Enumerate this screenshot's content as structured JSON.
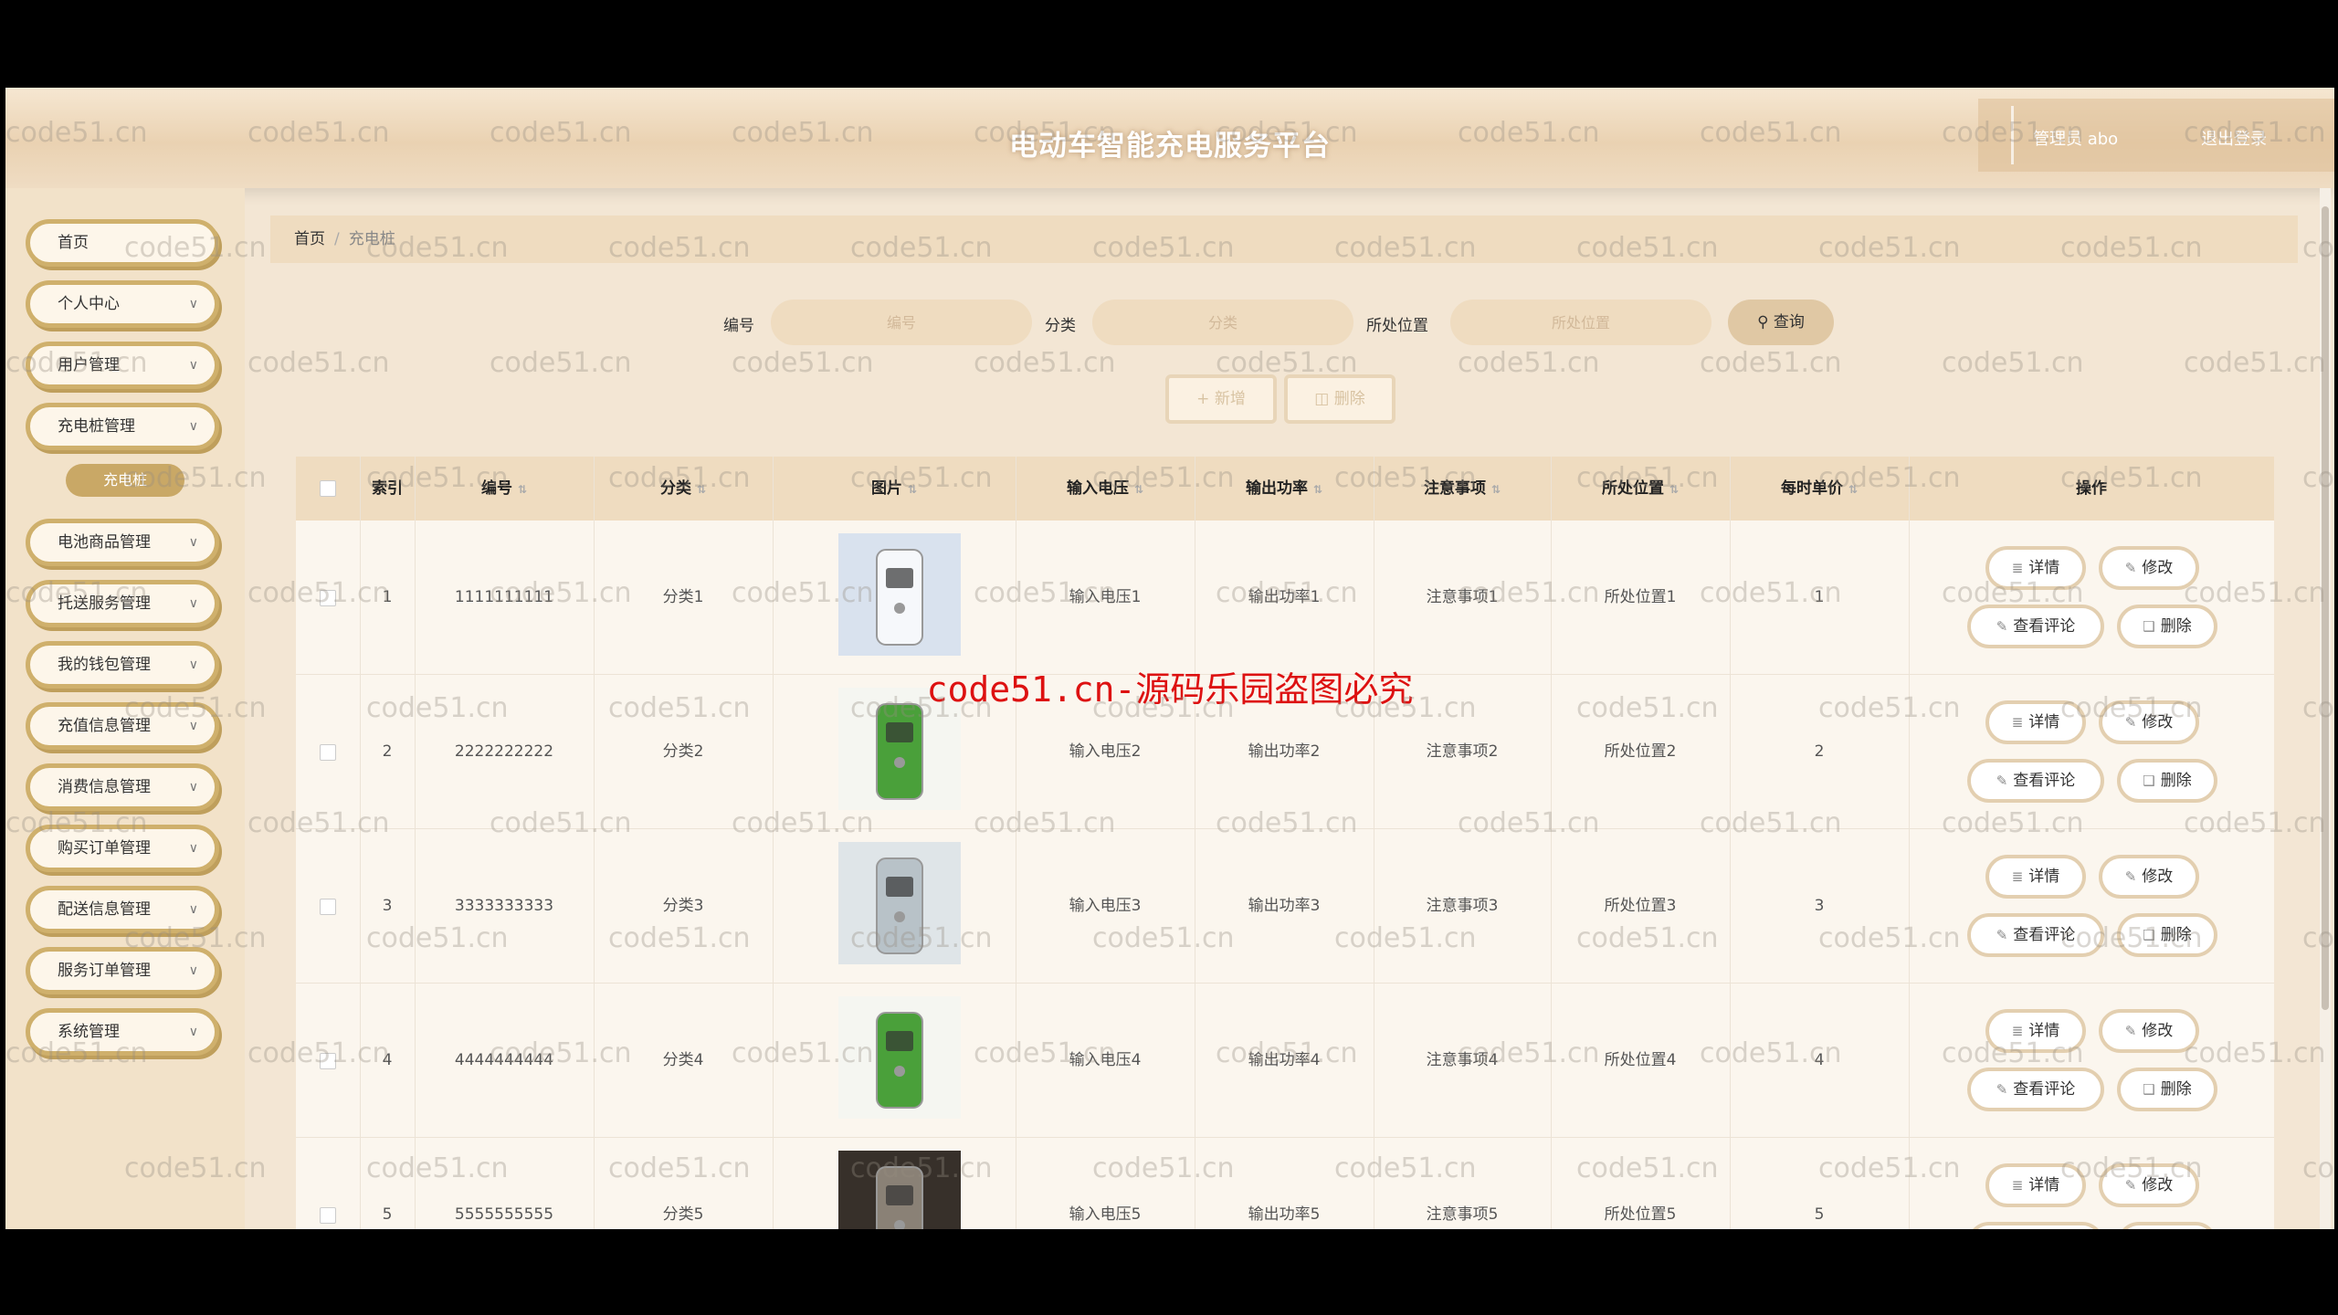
{
  "app_title": "电动车智能充电服务平台",
  "header": {
    "user_label": "管理员 abo",
    "logout_label": "退出登录"
  },
  "sidebar": {
    "items": [
      {
        "label": "首页",
        "has_arrow": false
      },
      {
        "label": "个人中心",
        "has_arrow": true
      },
      {
        "label": "用户管理",
        "has_arrow": true
      },
      {
        "label": "充电桩管理",
        "has_arrow": true
      },
      {
        "label": "电池商品管理",
        "has_arrow": true
      },
      {
        "label": "托送服务管理",
        "has_arrow": true
      },
      {
        "label": "我的钱包管理",
        "has_arrow": true
      },
      {
        "label": "充值信息管理",
        "has_arrow": true
      },
      {
        "label": "消费信息管理",
        "has_arrow": true
      },
      {
        "label": "购买订单管理",
        "has_arrow": true
      },
      {
        "label": "配送信息管理",
        "has_arrow": true
      },
      {
        "label": "服务订单管理",
        "has_arrow": true
      },
      {
        "label": "系统管理",
        "has_arrow": true
      }
    ],
    "active_sub": "充电桩"
  },
  "breadcrumb": {
    "home": "首页",
    "separator": "/",
    "current": "充电桩"
  },
  "search": {
    "field1_label": "编号",
    "field1_placeholder": "编号",
    "field2_label": "分类",
    "field2_placeholder": "分类",
    "field3_label": "所处位置",
    "field3_placeholder": "所处位置",
    "query_label": "查询"
  },
  "actions": {
    "add_label": "新增",
    "delete_label": "删除"
  },
  "table": {
    "headers": [
      "索引",
      "编号",
      "分类",
      "图片",
      "输入电压",
      "输出功率",
      "注意事项",
      "所处位置",
      "每时单价",
      "操作"
    ],
    "rows": [
      {
        "index": "1",
        "code": "1111111111",
        "category": "分类1",
        "voltage": "输入电压1",
        "power": "输出功率1",
        "notes": "注意事项1",
        "location": "所处位置1",
        "price": "1"
      },
      {
        "index": "2",
        "code": "2222222222",
        "category": "分类2",
        "voltage": "输入电压2",
        "power": "输出功率2",
        "notes": "注意事项2",
        "location": "所处位置2",
        "price": "2"
      },
      {
        "index": "3",
        "code": "3333333333",
        "category": "分类3",
        "voltage": "输入电压3",
        "power": "输出功率3",
        "notes": "注意事项3",
        "location": "所处位置3",
        "price": "3"
      },
      {
        "index": "4",
        "code": "4444444444",
        "category": "分类4",
        "voltage": "输入电压4",
        "power": "输出功率4",
        "notes": "注意事项4",
        "location": "所处位置4",
        "price": "4"
      },
      {
        "index": "5",
        "code": "5555555555",
        "category": "分类5",
        "voltage": "输入电压5",
        "power": "输出功率5",
        "notes": "注意事项5",
        "location": "所处位置5",
        "price": "5"
      }
    ],
    "row_buttons": {
      "detail": "详情",
      "edit": "修改",
      "comments": "查看评论",
      "delete": "删除"
    }
  },
  "watermark_text": "code51.cn-源码乐园盗图必究",
  "tile_watermark": "code51.cn",
  "colors": {
    "accent": "#cfb06c",
    "header_bg": "#efdcc0",
    "watermark": "#d11111"
  }
}
